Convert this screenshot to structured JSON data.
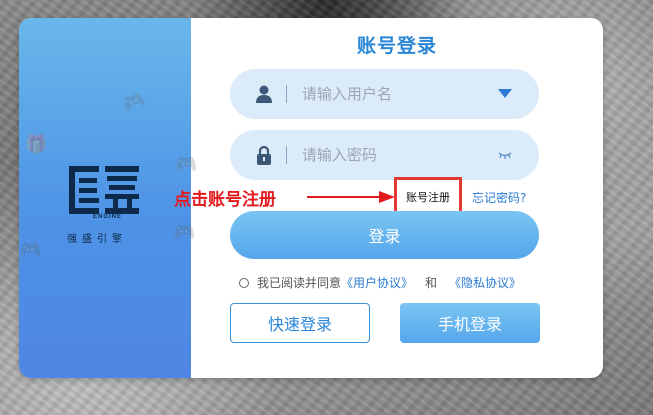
{
  "dialog": {
    "title": "账号登录",
    "brand": {
      "engine": "ENGINE",
      "name": "强盛引擎"
    },
    "username": {
      "placeholder": "请输入用户名",
      "value": ""
    },
    "password": {
      "placeholder": "请输入密码",
      "value": ""
    },
    "register_label": "账号注册",
    "forgot_label": "忘记密码?",
    "login_label": "登录",
    "agreement": {
      "prefix": "我已阅读并同意",
      "user_agreement": "《用户协议》",
      "and": "和",
      "privacy_policy": "《隐私协议》"
    },
    "quick_login_label": "快速登录",
    "phone_login_label": "手机登录"
  },
  "annotation": {
    "text": "点击账号注册",
    "color": "#e3191d"
  },
  "colors": {
    "accent": "#2a86d6",
    "panel_top": "#69b7ea",
    "panel_bottom": "#4f86e3",
    "input_bg": "#dcebfa",
    "highlight_border": "#e53935"
  },
  "icons": [
    "user-icon",
    "dropdown-arrow-icon",
    "lock-icon",
    "eye-closed-icon",
    "arrow-icon"
  ]
}
